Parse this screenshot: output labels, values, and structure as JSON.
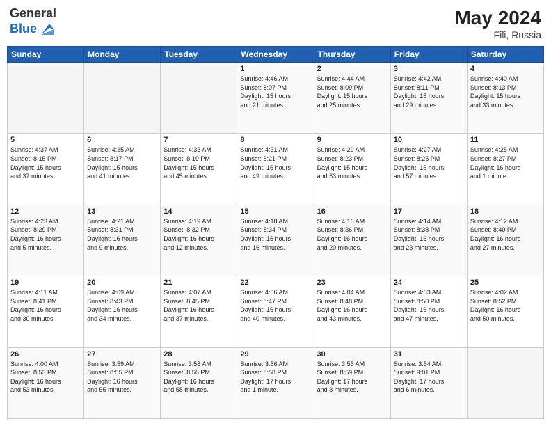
{
  "logo": {
    "general": "General",
    "blue": "Blue"
  },
  "header": {
    "month": "May 2024",
    "location": "Fili, Russia"
  },
  "days_of_week": [
    "Sunday",
    "Monday",
    "Tuesday",
    "Wednesday",
    "Thursday",
    "Friday",
    "Saturday"
  ],
  "weeks": [
    [
      {
        "day": "",
        "info": ""
      },
      {
        "day": "",
        "info": ""
      },
      {
        "day": "",
        "info": ""
      },
      {
        "day": "1",
        "info": "Sunrise: 4:46 AM\nSunset: 8:07 PM\nDaylight: 15 hours\nand 21 minutes."
      },
      {
        "day": "2",
        "info": "Sunrise: 4:44 AM\nSunset: 8:09 PM\nDaylight: 15 hours\nand 25 minutes."
      },
      {
        "day": "3",
        "info": "Sunrise: 4:42 AM\nSunset: 8:11 PM\nDaylight: 15 hours\nand 29 minutes."
      },
      {
        "day": "4",
        "info": "Sunrise: 4:40 AM\nSunset: 8:13 PM\nDaylight: 15 hours\nand 33 minutes."
      }
    ],
    [
      {
        "day": "5",
        "info": "Sunrise: 4:37 AM\nSunset: 8:15 PM\nDaylight: 15 hours\nand 37 minutes."
      },
      {
        "day": "6",
        "info": "Sunrise: 4:35 AM\nSunset: 8:17 PM\nDaylight: 15 hours\nand 41 minutes."
      },
      {
        "day": "7",
        "info": "Sunrise: 4:33 AM\nSunset: 8:19 PM\nDaylight: 15 hours\nand 45 minutes."
      },
      {
        "day": "8",
        "info": "Sunrise: 4:31 AM\nSunset: 8:21 PM\nDaylight: 15 hours\nand 49 minutes."
      },
      {
        "day": "9",
        "info": "Sunrise: 4:29 AM\nSunset: 8:23 PM\nDaylight: 15 hours\nand 53 minutes."
      },
      {
        "day": "10",
        "info": "Sunrise: 4:27 AM\nSunset: 8:25 PM\nDaylight: 15 hours\nand 57 minutes."
      },
      {
        "day": "11",
        "info": "Sunrise: 4:25 AM\nSunset: 8:27 PM\nDaylight: 16 hours\nand 1 minute."
      }
    ],
    [
      {
        "day": "12",
        "info": "Sunrise: 4:23 AM\nSunset: 8:29 PM\nDaylight: 16 hours\nand 5 minutes."
      },
      {
        "day": "13",
        "info": "Sunrise: 4:21 AM\nSunset: 8:31 PM\nDaylight: 16 hours\nand 9 minutes."
      },
      {
        "day": "14",
        "info": "Sunrise: 4:19 AM\nSunset: 8:32 PM\nDaylight: 16 hours\nand 12 minutes."
      },
      {
        "day": "15",
        "info": "Sunrise: 4:18 AM\nSunset: 8:34 PM\nDaylight: 16 hours\nand 16 minutes."
      },
      {
        "day": "16",
        "info": "Sunrise: 4:16 AM\nSunset: 8:36 PM\nDaylight: 16 hours\nand 20 minutes."
      },
      {
        "day": "17",
        "info": "Sunrise: 4:14 AM\nSunset: 8:38 PM\nDaylight: 16 hours\nand 23 minutes."
      },
      {
        "day": "18",
        "info": "Sunrise: 4:12 AM\nSunset: 8:40 PM\nDaylight: 16 hours\nand 27 minutes."
      }
    ],
    [
      {
        "day": "19",
        "info": "Sunrise: 4:11 AM\nSunset: 8:41 PM\nDaylight: 16 hours\nand 30 minutes."
      },
      {
        "day": "20",
        "info": "Sunrise: 4:09 AM\nSunset: 8:43 PM\nDaylight: 16 hours\nand 34 minutes."
      },
      {
        "day": "21",
        "info": "Sunrise: 4:07 AM\nSunset: 8:45 PM\nDaylight: 16 hours\nand 37 minutes."
      },
      {
        "day": "22",
        "info": "Sunrise: 4:06 AM\nSunset: 8:47 PM\nDaylight: 16 hours\nand 40 minutes."
      },
      {
        "day": "23",
        "info": "Sunrise: 4:04 AM\nSunset: 8:48 PM\nDaylight: 16 hours\nand 43 minutes."
      },
      {
        "day": "24",
        "info": "Sunrise: 4:03 AM\nSunset: 8:50 PM\nDaylight: 16 hours\nand 47 minutes."
      },
      {
        "day": "25",
        "info": "Sunrise: 4:02 AM\nSunset: 8:52 PM\nDaylight: 16 hours\nand 50 minutes."
      }
    ],
    [
      {
        "day": "26",
        "info": "Sunrise: 4:00 AM\nSunset: 8:53 PM\nDaylight: 16 hours\nand 53 minutes."
      },
      {
        "day": "27",
        "info": "Sunrise: 3:59 AM\nSunset: 8:55 PM\nDaylight: 16 hours\nand 55 minutes."
      },
      {
        "day": "28",
        "info": "Sunrise: 3:58 AM\nSunset: 8:56 PM\nDaylight: 16 hours\nand 58 minutes."
      },
      {
        "day": "29",
        "info": "Sunrise: 3:56 AM\nSunset: 8:58 PM\nDaylight: 17 hours\nand 1 minute."
      },
      {
        "day": "30",
        "info": "Sunrise: 3:55 AM\nSunset: 8:59 PM\nDaylight: 17 hours\nand 3 minutes."
      },
      {
        "day": "31",
        "info": "Sunrise: 3:54 AM\nSunset: 9:01 PM\nDaylight: 17 hours\nand 6 minutes."
      },
      {
        "day": "",
        "info": ""
      }
    ]
  ]
}
